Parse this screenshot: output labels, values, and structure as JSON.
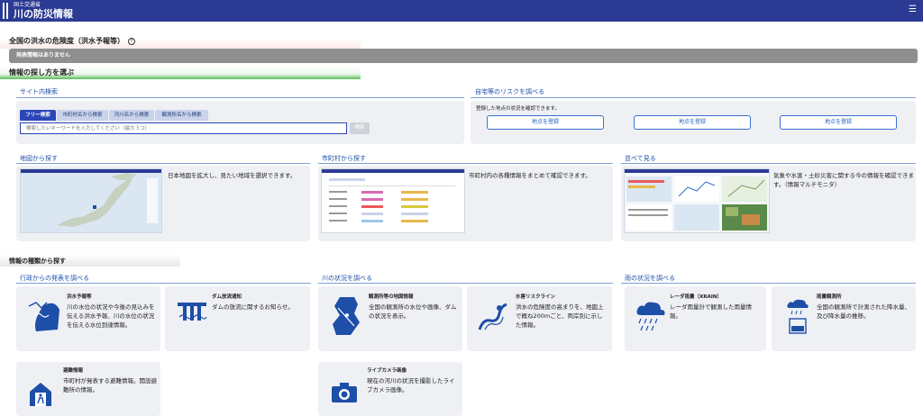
{
  "header": {
    "ministry": "国土交通省",
    "site_title": "川の防災情報",
    "menu_icon": "hamburger-menu-icon"
  },
  "flood_section": {
    "title": "全国の洪水の危険度（洪水予報等）",
    "help": "?",
    "notice": "発表情報はありません"
  },
  "find_section": {
    "title": "情報の探し方を選ぶ"
  },
  "site_search": {
    "title": "サイト内検索",
    "tabs": [
      "フリー検索",
      "市町村名から検索",
      "河川名から検索",
      "観測所名から検索"
    ],
    "active_tab": "フリー検索",
    "placeholder": "検索したいキーワードを入力してください（最大３つ）",
    "button": "検索"
  },
  "home_risk": {
    "title": "自宅等のリスクを調べる",
    "description": "登録した地点の状況を確認できます。",
    "buttons": [
      "地点を登録",
      "地点を登録",
      "地点を登録"
    ]
  },
  "map_search": {
    "title": "地図から探す",
    "description": "日本地図を拡大し、見たい地域を選択できます。"
  },
  "city_search": {
    "title": "市町村から探す",
    "description": "市町村内の各種情報をまとめて確認できます。"
  },
  "compare": {
    "title": "並べて見る",
    "description": "気象や水害・土砂災害に関する今の情報を確認できます。（情報マルチモニタ）"
  },
  "type_section": {
    "title": "情報の種類から探す"
  },
  "gov": {
    "title": "行政からの発表を調べる",
    "items": [
      {
        "title": "洪水予報等",
        "desc": "川の水位の状況や今後の見込みを伝える洪水予報、川の水位の状況を伝える水位到達情報。",
        "icon": "flood-forecast-icon"
      },
      {
        "title": "ダム放流通知",
        "desc": "ダムの放流に関するお知らせ。",
        "icon": "dam-release-icon"
      },
      {
        "title": "避難情報",
        "desc": "市町村が発表する避難情報。開設避難所の情報。",
        "icon": "evacuation-icon"
      }
    ]
  },
  "river": {
    "title": "川の状況を調べる",
    "items": [
      {
        "title": "観測所等の地図情報",
        "desc": "全国の観測所の水位や画像、ダムの状況を表示。",
        "icon": "station-map-icon"
      },
      {
        "title": "水害リスクライン",
        "desc": "洪水の危険度の高まりを、地図上で概ね200mごと、両岸別に示した情報。",
        "icon": "risk-line-icon"
      },
      {
        "title": "ライブカメラ画像",
        "desc": "現在の河川の状況を撮影したライブカメラ画像。",
        "icon": "camera-icon"
      }
    ]
  },
  "rain": {
    "title": "雨の状況を調べる",
    "items": [
      {
        "title": "レーダ雨量（XRAIN）",
        "desc": "レーダ雨量計で観測した雨量情報。",
        "icon": "radar-rain-icon"
      },
      {
        "title": "雨量観測所",
        "desc": "全国の観測所で計測された降水量、及び降水量の推移。",
        "icon": "rain-gauge-icon"
      }
    ]
  },
  "colors": {
    "header": "#2b3a93",
    "accent": "#2b46b8",
    "card": "#eef0f4",
    "notice": "#8f8f8f"
  }
}
